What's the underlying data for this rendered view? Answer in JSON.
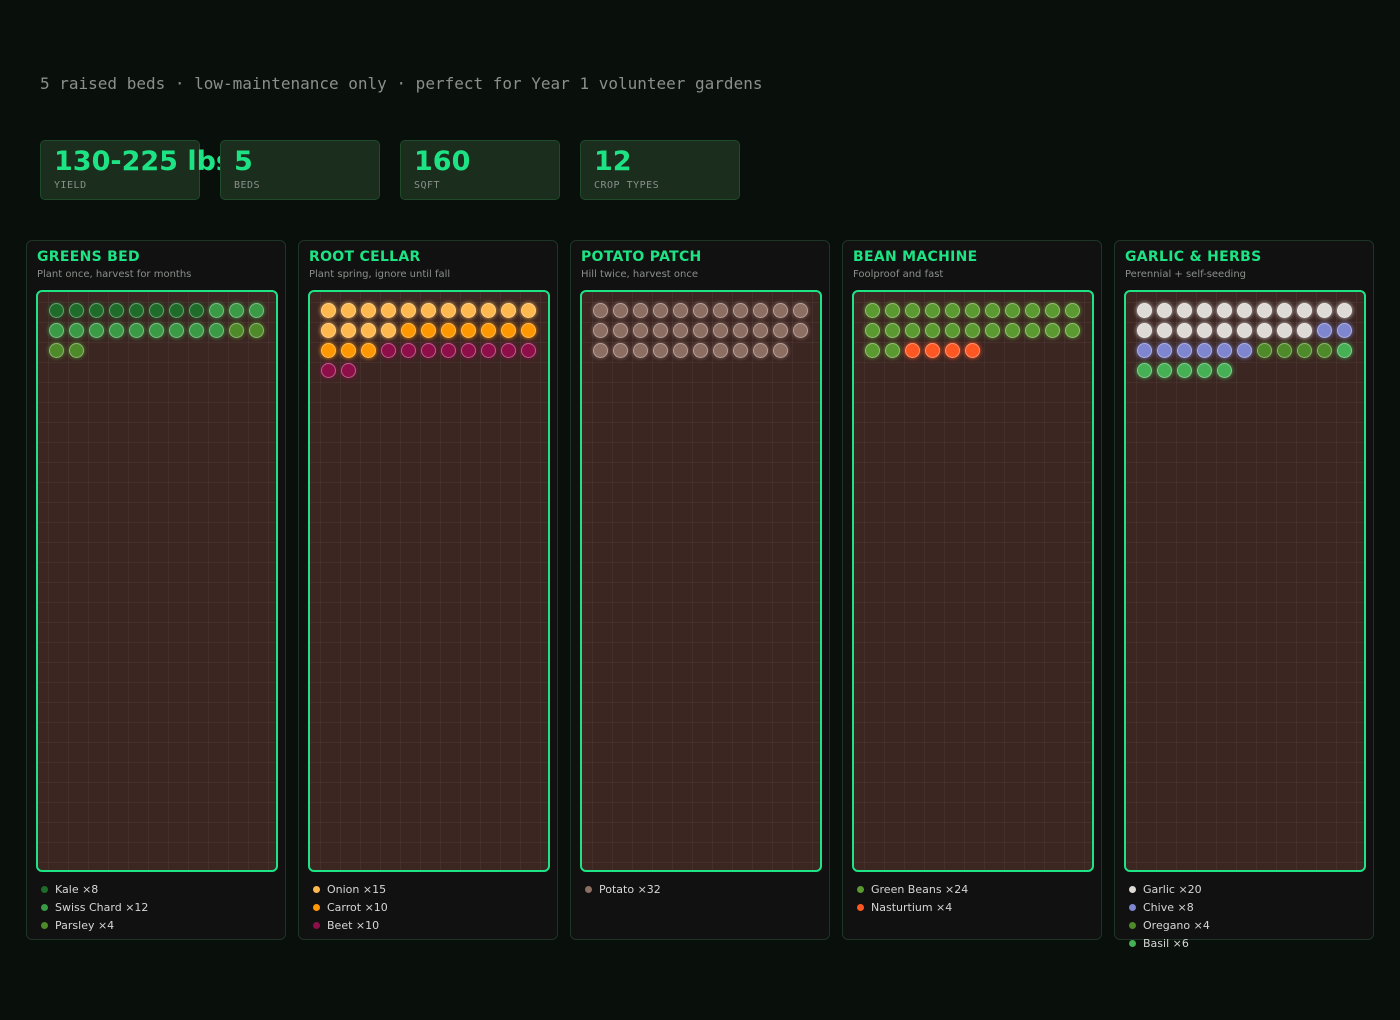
{
  "header": {
    "subtitle": "5 raised beds · low-maintenance only · perfect for Year 1 volunteer gardens"
  },
  "stats": [
    {
      "value": "130-225 lbs",
      "label": "YIELD"
    },
    {
      "value": "5",
      "label": "BEDS"
    },
    {
      "value": "160",
      "label": "SQFT"
    },
    {
      "value": "12",
      "label": "CROP TYPES"
    }
  ],
  "beds": [
    {
      "title": "GREENS BED",
      "subtitle": "Plant once, harvest for months",
      "crops": [
        {
          "label": "Kale ×8",
          "count": 8,
          "color": "#1e6b2a"
        },
        {
          "label": "Swiss Chard ×12",
          "count": 12,
          "color": "#3a9a45"
        },
        {
          "label": "Parsley ×4",
          "count": 4,
          "color": "#4f8a2a"
        }
      ]
    },
    {
      "title": "ROOT CELLAR",
      "subtitle": "Plant spring, ignore until fall",
      "crops": [
        {
          "label": "Onion ×15",
          "count": 15,
          "color": "#ffb84d"
        },
        {
          "label": "Carrot ×10",
          "count": 10,
          "color": "#ff9800"
        },
        {
          "label": "Beet ×10",
          "count": 10,
          "color": "#8e0e4a"
        }
      ]
    },
    {
      "title": "POTATO PATCH",
      "subtitle": "Hill twice, harvest once",
      "crops": [
        {
          "label": "Potato ×32",
          "count": 32,
          "color": "#8d6e63"
        }
      ]
    },
    {
      "title": "BEAN MACHINE",
      "subtitle": "Foolproof and fast",
      "crops": [
        {
          "label": "Green Beans ×24",
          "count": 24,
          "color": "#5b9a30"
        },
        {
          "label": "Nasturtium ×4",
          "count": 4,
          "color": "#ff5722"
        }
      ]
    },
    {
      "title": "GARLIC & HERBS",
      "subtitle": "Perennial + self-seeding",
      "crops": [
        {
          "label": "Garlic ×20",
          "count": 20,
          "color": "#dedad6"
        },
        {
          "label": "Chive ×8",
          "count": 8,
          "color": "#7f86d0"
        },
        {
          "label": "Oregano ×4",
          "count": 4,
          "color": "#4f8a2a"
        },
        {
          "label": "Basil ×6",
          "count": 6,
          "color": "#46b055"
        }
      ]
    }
  ]
}
